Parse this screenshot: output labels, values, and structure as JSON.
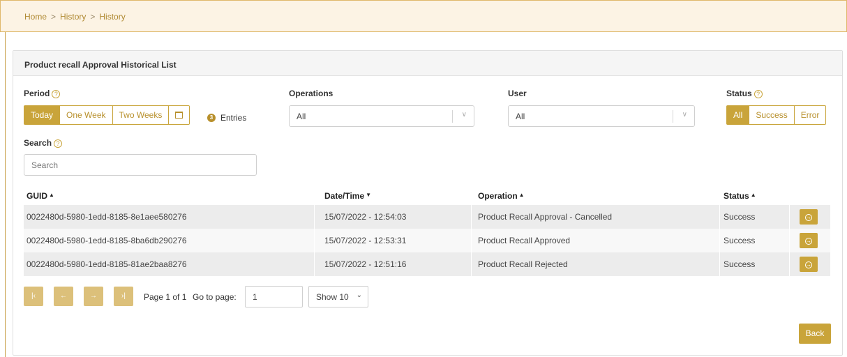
{
  "breadcrumb": [
    "Home",
    "History",
    "History"
  ],
  "breadcrumb_sep": ">",
  "panel_title": "Product recall Approval Historical List",
  "period": {
    "label": "Period",
    "options": [
      "Today",
      "One Week",
      "Two Weeks"
    ],
    "active": "Today",
    "calendar_icon": "calendar-icon",
    "entries_count": "3",
    "entries_label": "Entries"
  },
  "operations": {
    "label": "Operations",
    "value": "All"
  },
  "user": {
    "label": "User",
    "value": "All"
  },
  "status_filter": {
    "label": "Status",
    "options": [
      "All",
      "Success",
      "Error"
    ],
    "active": "All"
  },
  "search": {
    "label": "Search",
    "placeholder": "Search"
  },
  "table": {
    "headers": {
      "guid": "GUID",
      "datetime": "Date/Time",
      "operation": "Operation",
      "status": "Status"
    },
    "rows": [
      {
        "guid": "0022480d-5980-1edd-8185-8e1aee580276",
        "datetime": "15/07/2022 - 12:54:03",
        "operation": "Product Recall Approval - Cancelled",
        "status": "Success"
      },
      {
        "guid": "0022480d-5980-1edd-8185-8ba6db290276",
        "datetime": "15/07/2022 - 12:53:31",
        "operation": "Product Recall Approved",
        "status": "Success"
      },
      {
        "guid": "0022480d-5980-1edd-8185-81ae2baa8276",
        "datetime": "15/07/2022 - 12:51:16",
        "operation": "Product Recall Rejected",
        "status": "Success"
      }
    ]
  },
  "pager": {
    "page_text": "Page 1 of 1",
    "goto_label": "Go to page:",
    "goto_value": "1",
    "show_value": "Show 10"
  },
  "back_label": "Back",
  "colors": {
    "accent": "#c9a43a",
    "pager_disabled": "#dcc07a",
    "breadcrumb_bg": "#fcf3e4"
  }
}
